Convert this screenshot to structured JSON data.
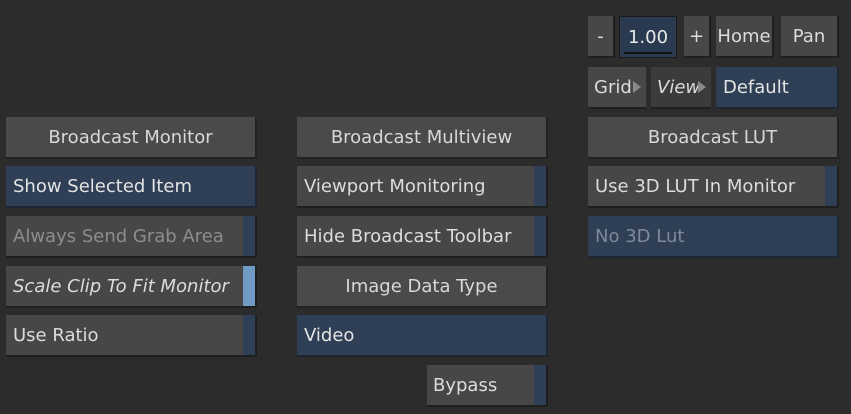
{
  "toolbar": {
    "zoom_minus": "-",
    "zoom_value": "1.00",
    "zoom_plus": "+",
    "home": "Home",
    "pan": "Pan",
    "grid": "Grid",
    "view": "View",
    "view_mode": "Default"
  },
  "broadcast_monitor": {
    "header": "Broadcast Monitor",
    "show_selected": "Show Selected Item",
    "always_send_grab": "Always Send Grab Area",
    "scale_clip": "Scale Clip To Fit Monitor",
    "use_ratio": "Use Ratio"
  },
  "broadcast_multiview": {
    "header": "Broadcast Multiview",
    "viewport_monitoring": "Viewport Monitoring",
    "hide_toolbar": "Hide Broadcast Toolbar",
    "image_data_type_header": "Image Data Type",
    "image_data_type_value": "Video",
    "bypass": "Bypass"
  },
  "broadcast_lut": {
    "header": "Broadcast LUT",
    "use_3d_lut": "Use 3D LUT In Monitor",
    "lut_value": "No 3D Lut"
  }
}
